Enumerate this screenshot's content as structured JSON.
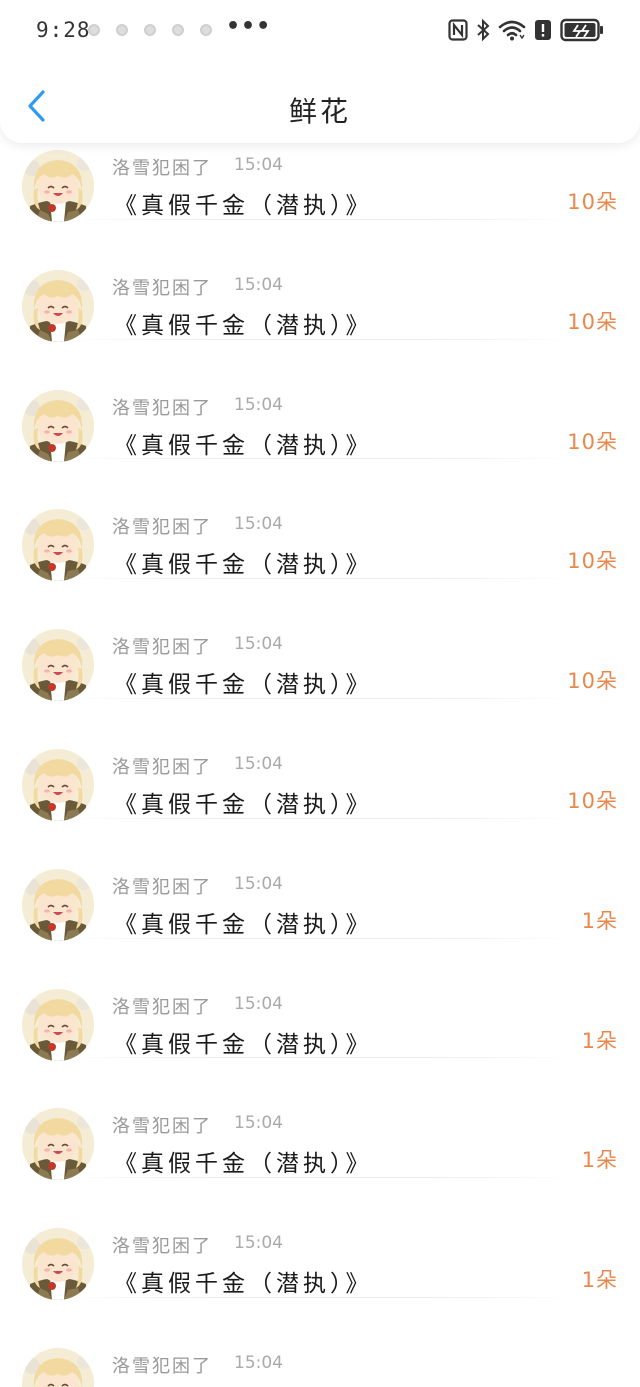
{
  "status_bar": {
    "time": "9:28",
    "more": "•••"
  },
  "header": {
    "title": "鲜花"
  },
  "colors": {
    "accent": "#2e9bf0",
    "count": "#e8884c",
    "name": "#999999",
    "title": "#1a1a1a"
  },
  "gifts": [
    {
      "name": "洛雪犯困了",
      "time": "15:04",
      "book": "《真假千金（潜执）》",
      "count": "10朵"
    },
    {
      "name": "洛雪犯困了",
      "time": "15:04",
      "book": "《真假千金（潜执）》",
      "count": "10朵"
    },
    {
      "name": "洛雪犯困了",
      "time": "15:04",
      "book": "《真假千金（潜执）》",
      "count": "10朵"
    },
    {
      "name": "洛雪犯困了",
      "time": "15:04",
      "book": "《真假千金（潜执）》",
      "count": "10朵"
    },
    {
      "name": "洛雪犯困了",
      "time": "15:04",
      "book": "《真假千金（潜执）》",
      "count": "10朵"
    },
    {
      "name": "洛雪犯困了",
      "time": "15:04",
      "book": "《真假千金（潜执）》",
      "count": "10朵"
    },
    {
      "name": "洛雪犯困了",
      "time": "15:04",
      "book": "《真假千金（潜执）》",
      "count": "1朵"
    },
    {
      "name": "洛雪犯困了",
      "time": "15:04",
      "book": "《真假千金（潜执）》",
      "count": "1朵"
    },
    {
      "name": "洛雪犯困了",
      "time": "15:04",
      "book": "《真假千金（潜执）》",
      "count": "1朵"
    },
    {
      "name": "洛雪犯困了",
      "time": "15:04",
      "book": "《真假千金（潜执）》",
      "count": "1朵"
    },
    {
      "name": "洛雪犯困了",
      "time": "15:04",
      "book": "《真假千金（潜执）》",
      "count": "1朵"
    }
  ]
}
